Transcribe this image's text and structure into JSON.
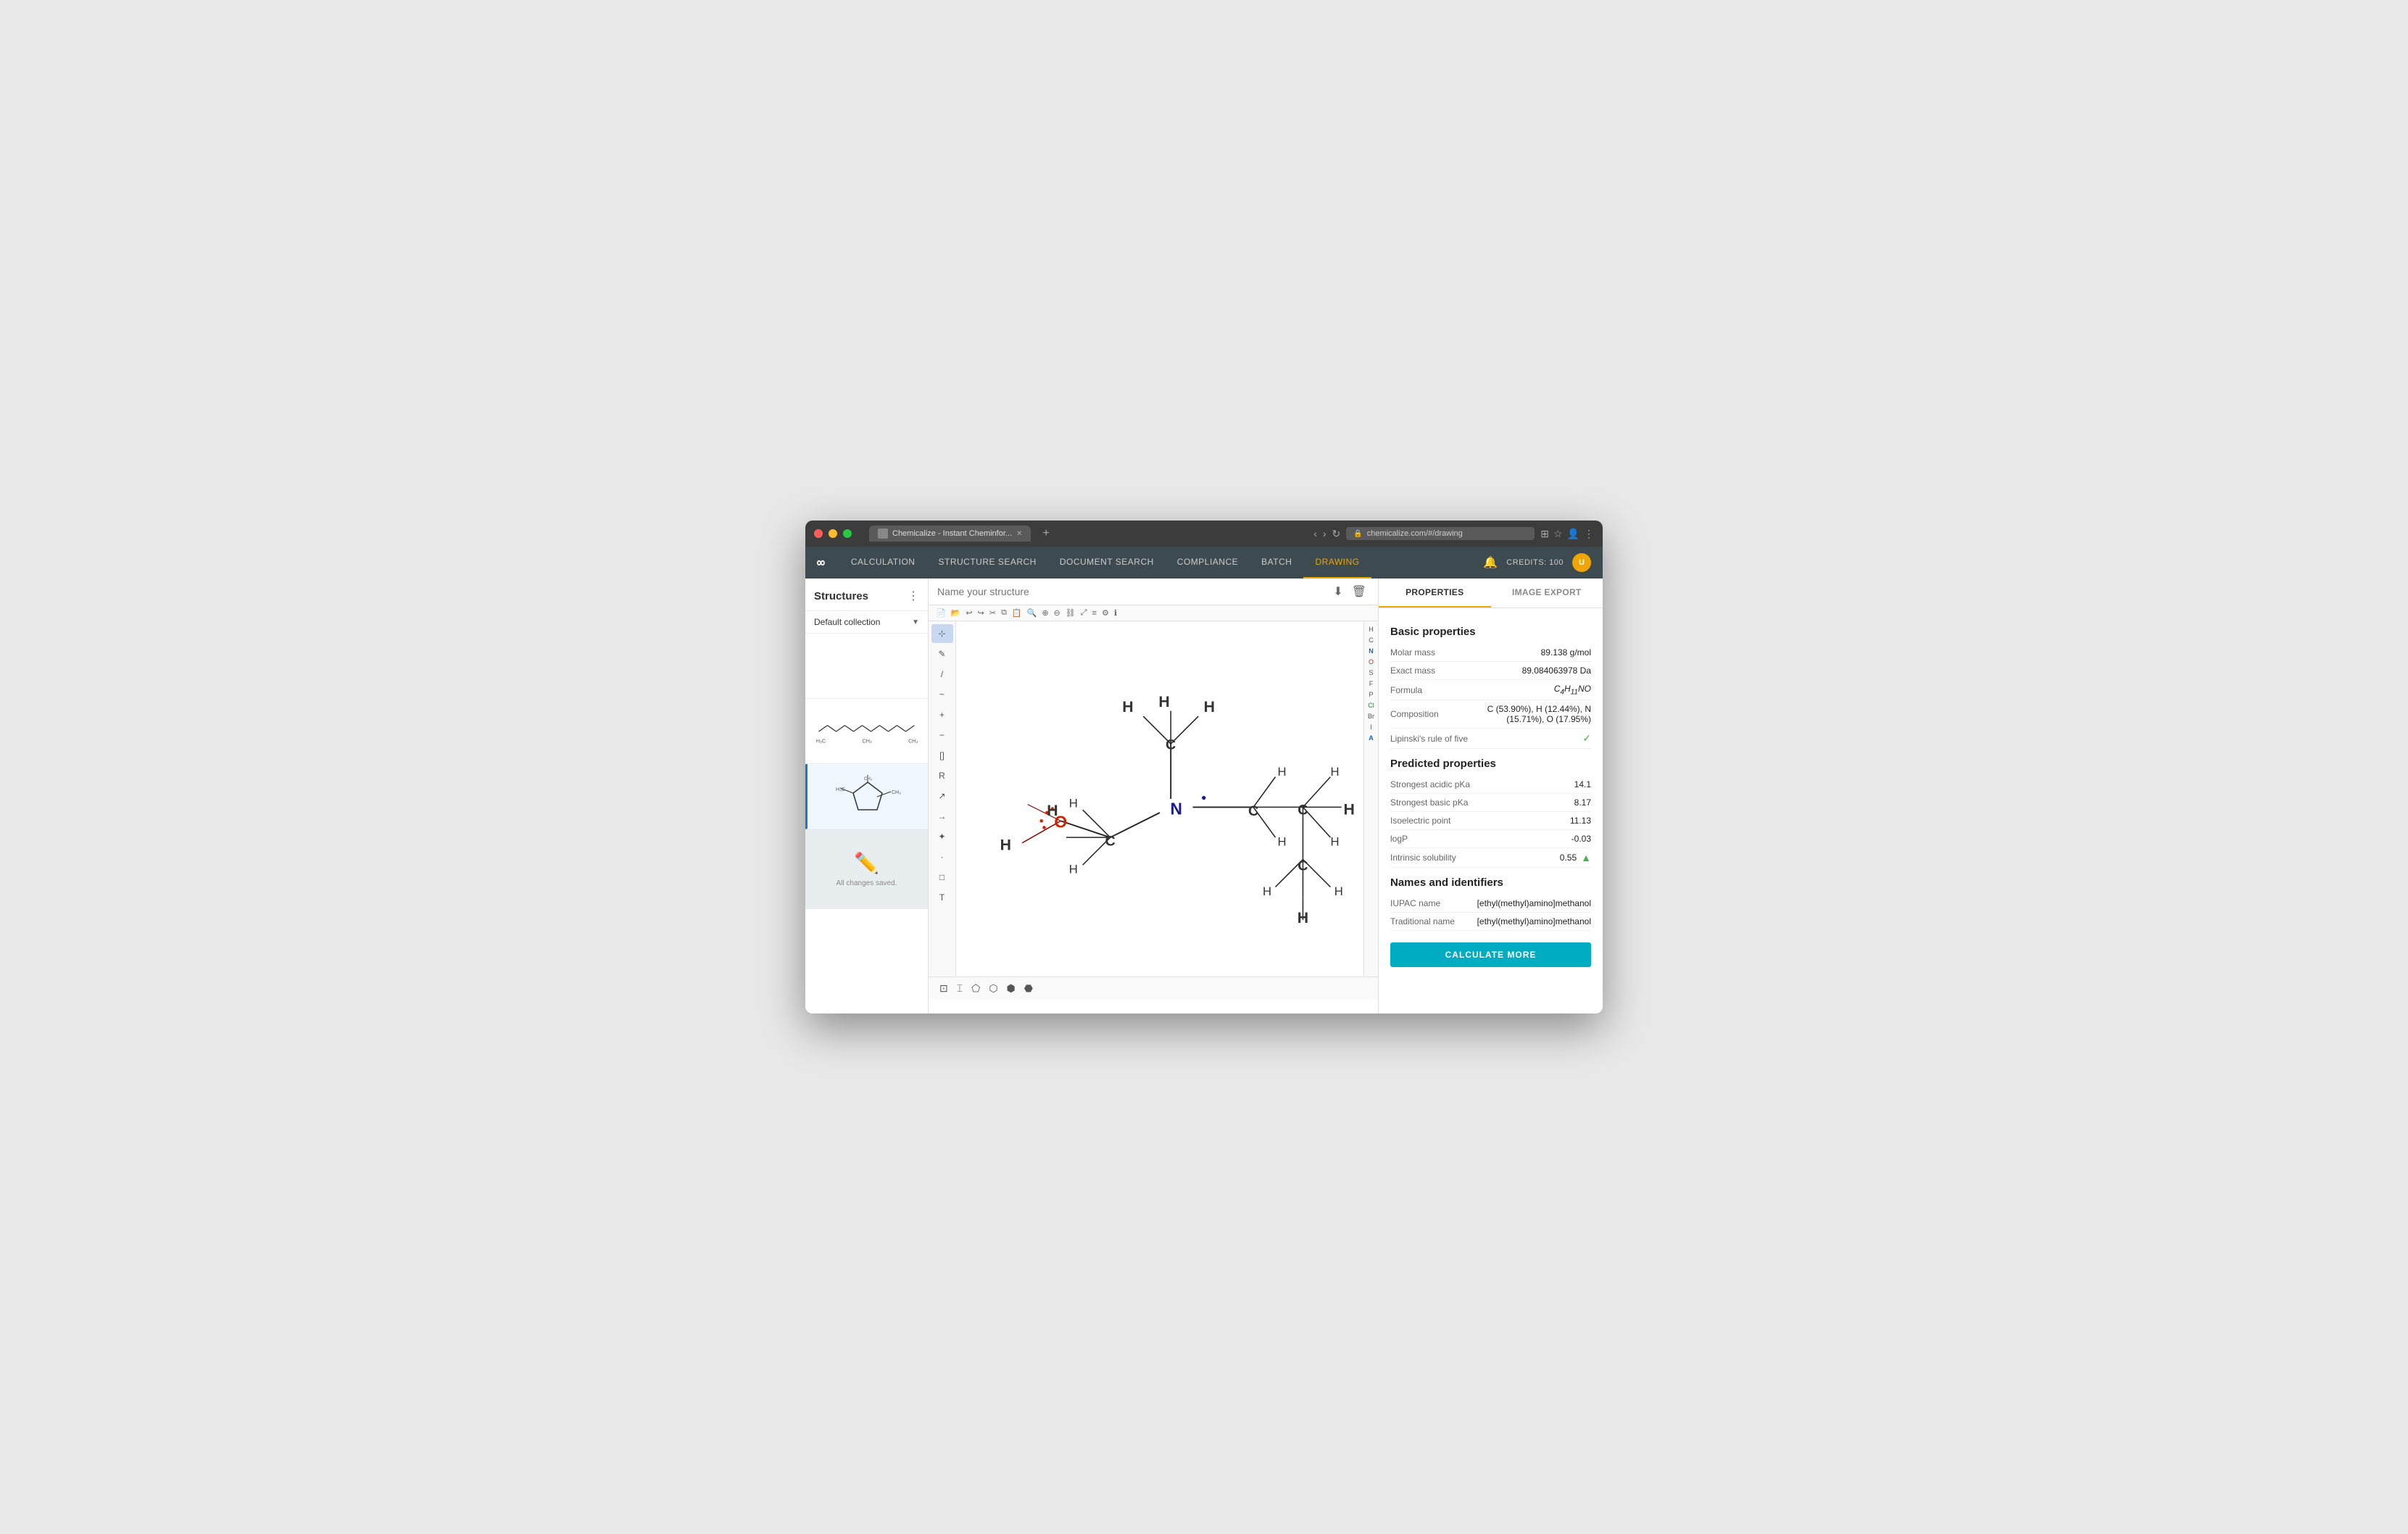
{
  "window": {
    "title": "Chemicalize - Instant Cheminfor...",
    "url": "chemicalize.com/#/drawing"
  },
  "navbar": {
    "logo": "∞",
    "items": [
      {
        "label": "CALCULATION",
        "active": false
      },
      {
        "label": "STRUCTURE SEARCH",
        "active": false
      },
      {
        "label": "DOCUMENT SEARCH",
        "active": false
      },
      {
        "label": "COMPLIANCE",
        "active": false
      },
      {
        "label": "BATCH",
        "active": false
      },
      {
        "label": "DRAWING",
        "active": true
      }
    ],
    "credits_label": "CREDITS: 100"
  },
  "sidebar": {
    "title": "Structures",
    "collection": "Default collection"
  },
  "drawing": {
    "structure_name_placeholder": "Name your structure"
  },
  "panel": {
    "tabs": [
      {
        "label": "PROPERTIES",
        "active": true
      },
      {
        "label": "IMAGE EXPORT",
        "active": false
      }
    ],
    "basic_properties": {
      "title": "Basic properties",
      "rows": [
        {
          "label": "Molar mass",
          "value": "89.138 g/mol"
        },
        {
          "label": "Exact mass",
          "value": "89.084063978 Da"
        },
        {
          "label": "Formula",
          "value": "C₄H₁₁NO"
        },
        {
          "label": "Composition",
          "value": "C (53.90%), H (12.44%), N (15.71%), O (17.95%)"
        },
        {
          "label": "Lipinski's rule of five",
          "value": "✓",
          "check": true
        }
      ]
    },
    "predicted_properties": {
      "title": "Predicted properties",
      "rows": [
        {
          "label": "Strongest acidic pKa",
          "value": "14.1"
        },
        {
          "label": "Strongest basic pKa",
          "value": "8.17"
        },
        {
          "label": "Isoelectric point",
          "value": "11.13"
        },
        {
          "label": "logP",
          "value": "-0.03"
        },
        {
          "label": "Intrinsic solubility",
          "value": "0.55",
          "arrow": true
        }
      ]
    },
    "names": {
      "title": "Names and identifiers",
      "rows": [
        {
          "label": "IUPAC name",
          "value": "[ethyl(methyl)amino]methanol"
        },
        {
          "label": "Traditional name",
          "value": "[ethyl(methyl)amino]methanol"
        }
      ]
    },
    "calculate_btn": "CALCULATE MORE"
  },
  "elements": [
    "H",
    "C",
    "N",
    "O",
    "S",
    "F",
    "P",
    "Cl",
    "Br",
    "I",
    "A"
  ],
  "all_changes_saved": "All changes saved."
}
